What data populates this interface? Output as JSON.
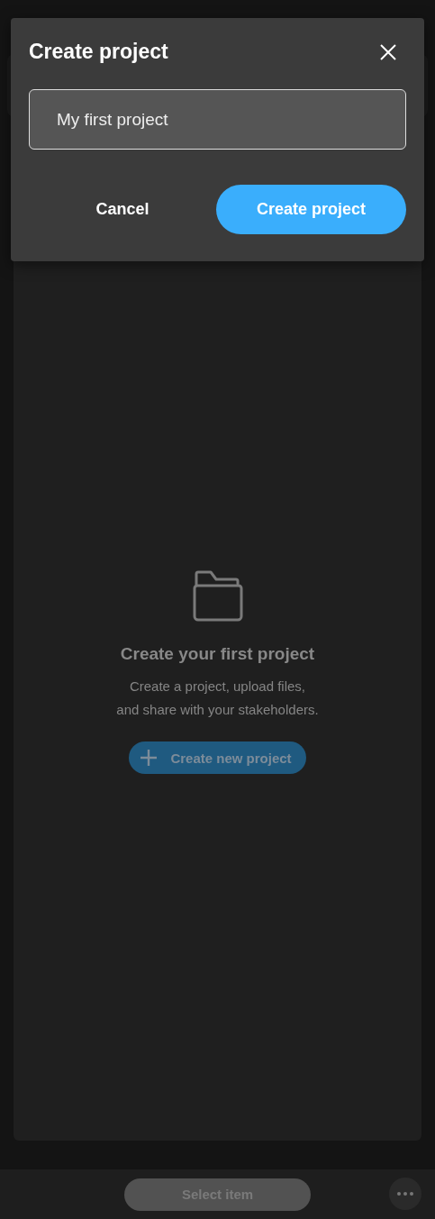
{
  "dialog": {
    "title": "Create project",
    "name_field": {
      "value": "My first project"
    },
    "buttons": [
      {
        "label": "Cancel",
        "kind": "text"
      },
      {
        "label": "Create project",
        "kind": "primary"
      }
    ]
  },
  "empty_state": {
    "title": "Create your first project",
    "description_lines": [
      "Create a project, upload files,",
      "and share with your stakeholders."
    ],
    "button": {
      "label": "Create new project"
    }
  },
  "bottom_bar": {
    "select_button": {
      "label": "Select item",
      "disabled": true
    }
  }
}
